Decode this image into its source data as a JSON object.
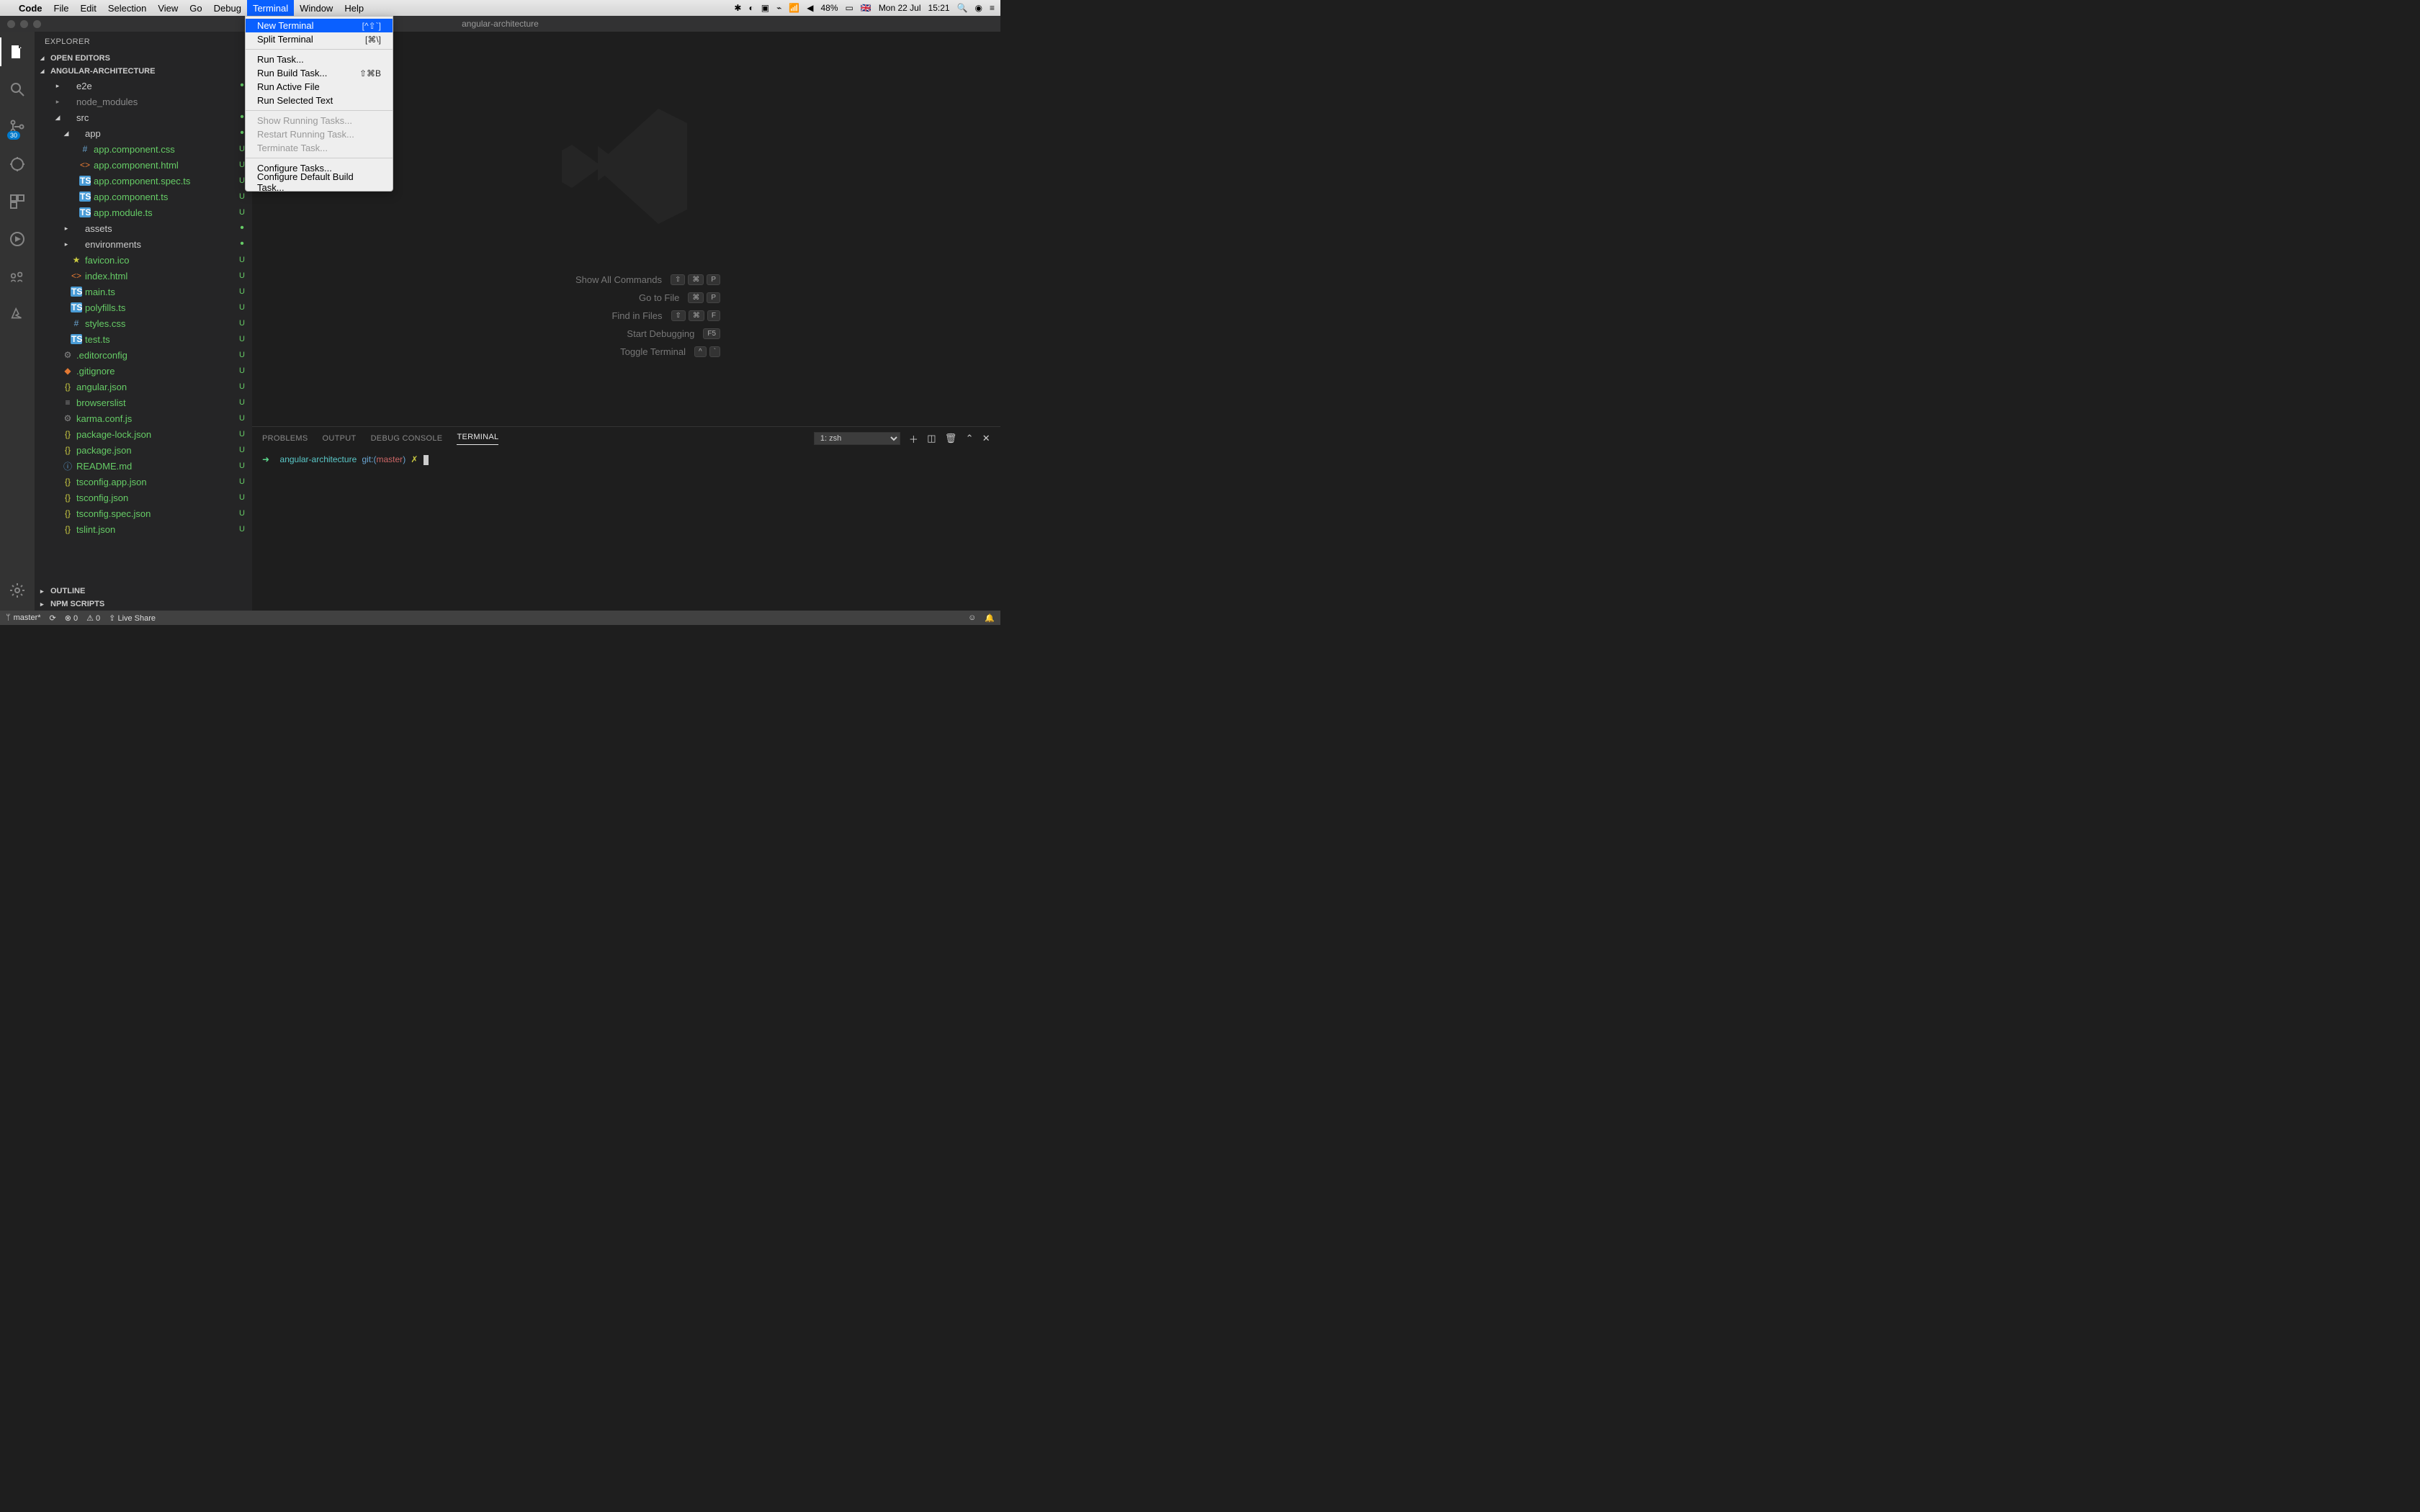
{
  "mac_menu": {
    "app": "Code",
    "items": [
      "File",
      "Edit",
      "Selection",
      "View",
      "Go",
      "Debug",
      "Terminal",
      "Window",
      "Help"
    ],
    "active": "Terminal",
    "status": {
      "battery": "48%",
      "flag": "🇬🇧",
      "date": "Mon 22 Jul",
      "time": "15:21"
    }
  },
  "dropdown": {
    "groups": [
      [
        {
          "label": "New Terminal",
          "sc": "[^⇧`]",
          "hl": true
        },
        {
          "label": "Split Terminal",
          "sc": "[⌘\\]"
        }
      ],
      [
        {
          "label": "Run Task..."
        },
        {
          "label": "Run Build Task...",
          "sc": "⇧⌘B"
        },
        {
          "label": "Run Active File"
        },
        {
          "label": "Run Selected Text"
        }
      ],
      [
        {
          "label": "Show Running Tasks...",
          "disabled": true
        },
        {
          "label": "Restart Running Task...",
          "disabled": true
        },
        {
          "label": "Terminate Task...",
          "disabled": true
        }
      ],
      [
        {
          "label": "Configure Tasks..."
        },
        {
          "label": "Configure Default Build Task..."
        }
      ]
    ]
  },
  "window": {
    "title": "angular-architecture"
  },
  "activity": {
    "badge": "30"
  },
  "sidebar": {
    "title": "EXPLORER",
    "sections": {
      "open_editors": "OPEN EDITORS",
      "project": "ANGULAR-ARCHITECTURE",
      "outline": "OUTLINE",
      "npm": "NPM SCRIPTS"
    },
    "tree": [
      {
        "ind": 2,
        "tw": "▸",
        "ico": "",
        "name": "e2e",
        "status": "•",
        "git": false
      },
      {
        "ind": 2,
        "tw": "▸",
        "ico": "",
        "name": "node_modules",
        "status": "",
        "git": false,
        "dim": true
      },
      {
        "ind": 2,
        "tw": "◢",
        "ico": "",
        "name": "src",
        "status": "•",
        "git": false
      },
      {
        "ind": 3,
        "tw": "◢",
        "ico": "",
        "name": "app",
        "status": "•",
        "git": false
      },
      {
        "ind": 4,
        "tw": "",
        "ico": "#",
        "cls": "ic-hash",
        "name": "app.component.css",
        "status": "U",
        "git": true
      },
      {
        "ind": 4,
        "tw": "",
        "ico": "<>",
        "cls": "ic-html",
        "name": "app.component.html",
        "status": "U",
        "git": true
      },
      {
        "ind": 4,
        "tw": "",
        "ico": "TS",
        "cls": "ic-ts",
        "name": "app.component.spec.ts",
        "status": "U",
        "git": true
      },
      {
        "ind": 4,
        "tw": "",
        "ico": "TS",
        "cls": "ic-ts",
        "name": "app.component.ts",
        "status": "U",
        "git": true
      },
      {
        "ind": 4,
        "tw": "",
        "ico": "TS",
        "cls": "ic-ts",
        "name": "app.module.ts",
        "status": "U",
        "git": true
      },
      {
        "ind": 3,
        "tw": "▸",
        "ico": "",
        "name": "assets",
        "status": "•",
        "git": false
      },
      {
        "ind": 3,
        "tw": "▸",
        "ico": "",
        "name": "environments",
        "status": "•",
        "git": false
      },
      {
        "ind": 3,
        "tw": "",
        "ico": "★",
        "cls": "ic-star",
        "name": "favicon.ico",
        "status": "U",
        "git": true
      },
      {
        "ind": 3,
        "tw": "",
        "ico": "<>",
        "cls": "ic-html",
        "name": "index.html",
        "status": "U",
        "git": true
      },
      {
        "ind": 3,
        "tw": "",
        "ico": "TS",
        "cls": "ic-ts",
        "name": "main.ts",
        "status": "U",
        "git": true
      },
      {
        "ind": 3,
        "tw": "",
        "ico": "TS",
        "cls": "ic-ts",
        "name": "polyfills.ts",
        "status": "U",
        "git": true
      },
      {
        "ind": 3,
        "tw": "",
        "ico": "#",
        "cls": "ic-hash",
        "name": "styles.css",
        "status": "U",
        "git": true
      },
      {
        "ind": 3,
        "tw": "",
        "ico": "TS",
        "cls": "ic-ts",
        "name": "test.ts",
        "status": "U",
        "git": true
      },
      {
        "ind": 2,
        "tw": "",
        "ico": "⚙",
        "cls": "ic-gear",
        "name": ".editorconfig",
        "status": "U",
        "git": true
      },
      {
        "ind": 2,
        "tw": "",
        "ico": "◆",
        "cls": "ic-git",
        "name": ".gitignore",
        "status": "U",
        "git": true
      },
      {
        "ind": 2,
        "tw": "",
        "ico": "{}",
        "cls": "ic-json",
        "name": "angular.json",
        "status": "U",
        "git": true
      },
      {
        "ind": 2,
        "tw": "",
        "ico": "≡",
        "cls": "ic-gear",
        "name": "browserslist",
        "status": "U",
        "git": true
      },
      {
        "ind": 2,
        "tw": "",
        "ico": "⚙",
        "cls": "ic-gear",
        "name": "karma.conf.js",
        "status": "U",
        "git": true
      },
      {
        "ind": 2,
        "tw": "",
        "ico": "{}",
        "cls": "ic-json",
        "name": "package-lock.json",
        "status": "U",
        "git": true
      },
      {
        "ind": 2,
        "tw": "",
        "ico": "{}",
        "cls": "ic-json",
        "name": "package.json",
        "status": "U",
        "git": true
      },
      {
        "ind": 2,
        "tw": "",
        "ico": "ⓘ",
        "cls": "ic-md",
        "name": "README.md",
        "status": "U",
        "git": true
      },
      {
        "ind": 2,
        "tw": "",
        "ico": "{}",
        "cls": "ic-json",
        "name": "tsconfig.app.json",
        "status": "U",
        "git": true
      },
      {
        "ind": 2,
        "tw": "",
        "ico": "{}",
        "cls": "ic-json",
        "name": "tsconfig.json",
        "status": "U",
        "git": true
      },
      {
        "ind": 2,
        "tw": "",
        "ico": "{}",
        "cls": "ic-json",
        "name": "tsconfig.spec.json",
        "status": "U",
        "git": true
      },
      {
        "ind": 2,
        "tw": "",
        "ico": "{}",
        "cls": "ic-json",
        "name": "tslint.json",
        "status": "U",
        "git": true
      }
    ]
  },
  "welcome": {
    "shortcuts": [
      {
        "label": "Show All Commands",
        "keys": [
          "⇧",
          "⌘",
          "P"
        ]
      },
      {
        "label": "Go to File",
        "keys": [
          "⌘",
          "P"
        ]
      },
      {
        "label": "Find in Files",
        "keys": [
          "⇧",
          "⌘",
          "F"
        ]
      },
      {
        "label": "Start Debugging",
        "keys": [
          "F5"
        ]
      },
      {
        "label": "Toggle Terminal",
        "keys": [
          "^",
          "`"
        ]
      }
    ]
  },
  "panel": {
    "tabs": [
      "PROBLEMS",
      "OUTPUT",
      "DEBUG CONSOLE",
      "TERMINAL"
    ],
    "active": "TERMINAL",
    "select": "1: zsh",
    "term": {
      "arrow": "➜",
      "dir": "angular-architecture",
      "git": "git:(",
      "branch": "master",
      "git2": ")",
      "x": "✗"
    }
  },
  "status": {
    "branch": "master*",
    "sync": "⟳",
    "errors": "⊗ 0",
    "warnings": "⚠ 0",
    "share": "⇪ Live Share",
    "face": "☺",
    "bell": "🔔"
  }
}
